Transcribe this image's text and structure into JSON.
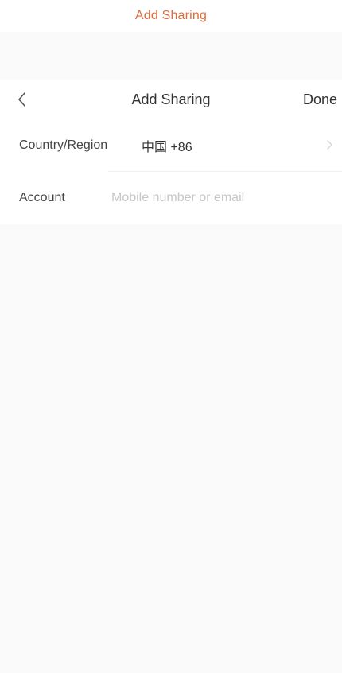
{
  "top_banner": {
    "text": "Add Sharing",
    "color": "#e06a3a"
  },
  "header": {
    "back_icon": "chevron-left-icon",
    "title": "Add Sharing",
    "done_label": "Done"
  },
  "form": {
    "country_region": {
      "label": "Country/Region",
      "value": "中国 +86",
      "icon": "chevron-right-icon"
    },
    "account": {
      "label": "Account",
      "placeholder": "Mobile number or email",
      "value": ""
    }
  }
}
